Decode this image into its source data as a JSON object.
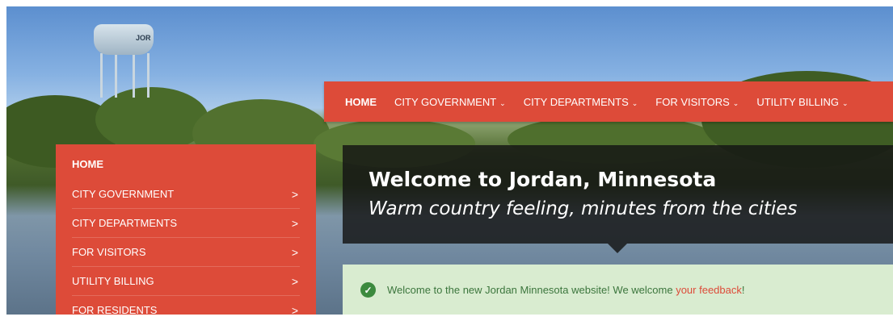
{
  "top_nav": {
    "items": [
      {
        "label": "HOME",
        "active": true,
        "has_dropdown": false
      },
      {
        "label": "CITY GOVERNMENT",
        "active": false,
        "has_dropdown": true
      },
      {
        "label": "CITY DEPARTMENTS",
        "active": false,
        "has_dropdown": true
      },
      {
        "label": "FOR VISITORS",
        "active": false,
        "has_dropdown": true
      },
      {
        "label": "UTILITY BILLING",
        "active": false,
        "has_dropdown": true
      }
    ],
    "chevron": "⌄"
  },
  "side_nav": {
    "items": [
      {
        "label": "HOME"
      },
      {
        "label": "CITY GOVERNMENT",
        "arrow": ">"
      },
      {
        "label": "CITY DEPARTMENTS",
        "arrow": ">"
      },
      {
        "label": "FOR VISITORS",
        "arrow": ">"
      },
      {
        "label": "UTILITY BILLING",
        "arrow": ">"
      },
      {
        "label": "FOR RESIDENTS",
        "arrow": ">"
      }
    ]
  },
  "welcome": {
    "title": "Welcome to Jordan, Minnesota",
    "subtitle": "Warm country feeling, minutes from the cities"
  },
  "alert": {
    "text": "Welcome to the new Jordan Minnesota website! We welcome ",
    "link_text": "your feedback",
    "suffix": "!",
    "icon": "check-circle-icon"
  },
  "hero": {
    "tower_text": "JOR"
  },
  "colors": {
    "brand": "#dd4b39",
    "alert_bg": "#d9ecd0",
    "alert_text": "#3c763d",
    "banner_bg": "#141414"
  }
}
